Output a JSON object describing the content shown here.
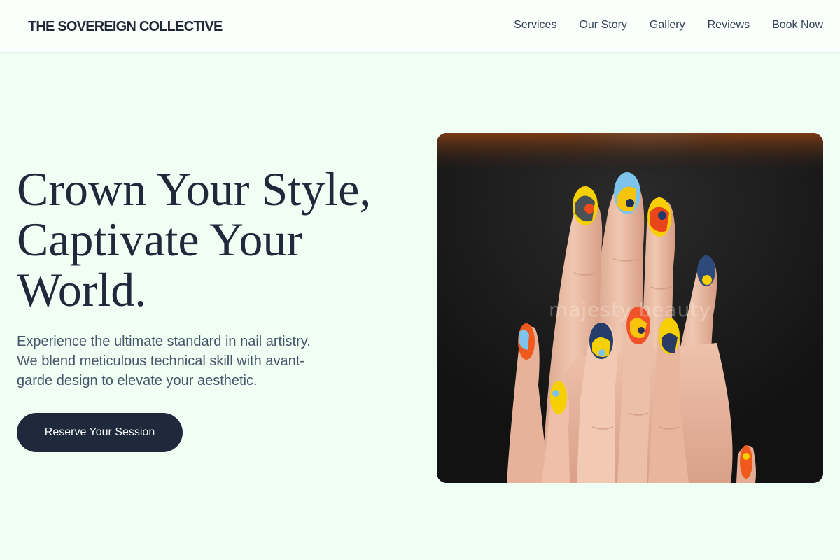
{
  "header": {
    "brand": "THE SOVEREIGN COLLECTIVE",
    "nav": [
      {
        "label": "Services"
      },
      {
        "label": "Our Story"
      },
      {
        "label": "Gallery"
      },
      {
        "label": "Reviews"
      },
      {
        "label": "Book Now"
      }
    ]
  },
  "hero": {
    "title": "Crown Your Style, Captivate Your World.",
    "subtitle": "Experience the ultimate standard in nail artistry. We blend meticulous technical skill with avant-garde design to elevate your aesthetic.",
    "cta_label": "Reserve Your Session",
    "image": {
      "watermark": "majesty beauty"
    }
  },
  "colors": {
    "page_background": "#f0fff4",
    "primary_text": "#1e293b",
    "muted_text": "#475569",
    "button_background": "#1e293b",
    "button_text": "#f8fafc"
  }
}
